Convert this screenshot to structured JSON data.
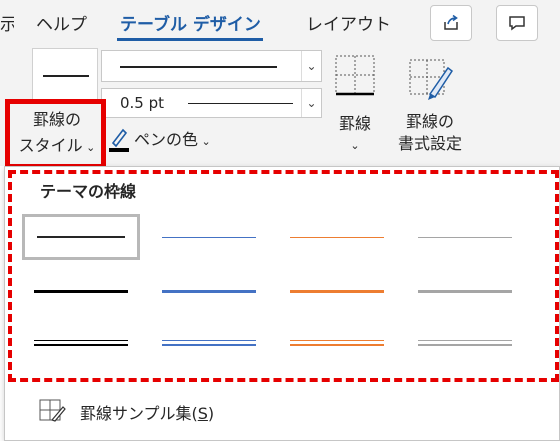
{
  "tabs": {
    "cut": "示",
    "help": "ヘルプ",
    "table_design": "テーブル デザイン",
    "layout": "レイアウト"
  },
  "ribbon": {
    "border_styles_label_line1": "罫線の",
    "border_styles_label_line2": "スタイル",
    "pen_weight": "0.5 pt",
    "pen_color_label": "ペンの色",
    "borders_label": "罫線",
    "border_painter_line1": "罫線の",
    "border_painter_line2": "書式設定"
  },
  "panel": {
    "title": "テーマの枠線",
    "footer_prefix": "罫線サンプル集(",
    "footer_key": "S",
    "footer_suffix": ")"
  },
  "colors": {
    "accent": "#1f5da6",
    "highlight": "#e60000",
    "row_colors": [
      "#262626",
      "#4472c4",
      "#ed7d31",
      "#a5a5a5"
    ]
  },
  "icons": {
    "share": "share-icon",
    "comment": "comment-icon",
    "borders": "borders-grid-icon",
    "painter": "border-painter-icon",
    "pen": "pen-icon",
    "sample": "border-sample-icon"
  }
}
